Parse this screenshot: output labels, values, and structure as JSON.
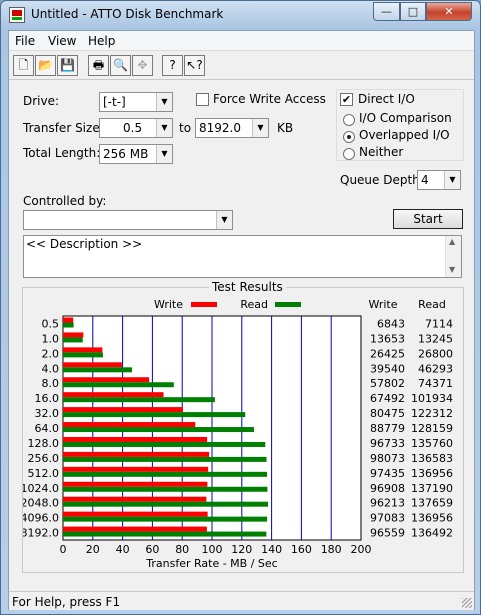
{
  "window": {
    "title": "Untitled - ATTO Disk Benchmark",
    "controls": {
      "minimize": "—",
      "maximize": "□",
      "close": "✕"
    }
  },
  "menu": [
    "File",
    "View",
    "Help"
  ],
  "toolbar": [
    {
      "name": "new-icon",
      "glyph": "🗋",
      "enabled": true
    },
    {
      "name": "open-icon",
      "glyph": "📂",
      "enabled": true
    },
    {
      "name": "save-icon",
      "glyph": "💾",
      "enabled": true
    },
    {
      "name": "print-icon",
      "glyph": "🖶",
      "enabled": true
    },
    {
      "name": "print-preview-icon",
      "glyph": "🔍",
      "enabled": true
    },
    {
      "name": "move-icon",
      "glyph": "✥",
      "enabled": false
    },
    {
      "name": "help-icon",
      "glyph": "?",
      "enabled": true
    },
    {
      "name": "context-help-icon",
      "glyph": "↖?",
      "enabled": true
    }
  ],
  "settings": {
    "drive_label": "Drive:",
    "drive_value": "[-t-]",
    "transfer_size_label": "Transfer Size:",
    "transfer_from": "0.5",
    "to_label": "to",
    "transfer_to": "8192.0",
    "unit": "KB",
    "total_length_label": "Total Length:",
    "total_length_value": "256 MB",
    "force_write_access_label": "Force Write Access",
    "force_write_access": false,
    "direct_io_label": "Direct I/O",
    "direct_io": true,
    "io_options": [
      {
        "label": "I/O Comparison",
        "selected": false
      },
      {
        "label": "Overlapped I/O",
        "selected": true
      },
      {
        "label": "Neither",
        "selected": false
      }
    ],
    "queue_depth_label": "Queue Depth:",
    "queue_depth_value": "4",
    "controlled_by_label": "Controlled by:",
    "controlled_by_value": "",
    "start_label": "Start",
    "description": "<< Description >>"
  },
  "results": {
    "title": "Test Results",
    "write_legend": "Write",
    "read_legend": "Read",
    "write_header": "Write",
    "read_header": "Read"
  },
  "colors": {
    "write": "#ff0000",
    "read": "#008000",
    "grid": "#0000c0"
  },
  "chart_data": {
    "type": "bar",
    "orientation": "horizontal",
    "categories": [
      "0.5",
      "1.0",
      "2.0",
      "4.0",
      "8.0",
      "16.0",
      "32.0",
      "64.0",
      "128.0",
      "256.0",
      "512.0",
      "1024.0",
      "2048.0",
      "4096.0",
      "8192.0"
    ],
    "series": [
      {
        "name": "Write",
        "values": [
          6843,
          13653,
          26425,
          39540,
          57802,
          67492,
          80475,
          88779,
          96733,
          98073,
          97435,
          96908,
          96213,
          97083,
          96559
        ]
      },
      {
        "name": "Read",
        "values": [
          7114,
          13245,
          26800,
          46293,
          74371,
          101934,
          122312,
          128159,
          135760,
          136583,
          136956,
          137190,
          137659,
          136956,
          136492
        ]
      }
    ],
    "xlabel": "Transfer Rate - MB / Sec",
    "xticks": [
      0,
      20,
      40,
      60,
      80,
      100,
      120,
      140,
      160,
      180,
      200
    ],
    "xlim": [
      0,
      200
    ],
    "value_unit_divisor": 1000,
    "legend": "top"
  },
  "statusbar": {
    "text": "For Help, press F1"
  }
}
